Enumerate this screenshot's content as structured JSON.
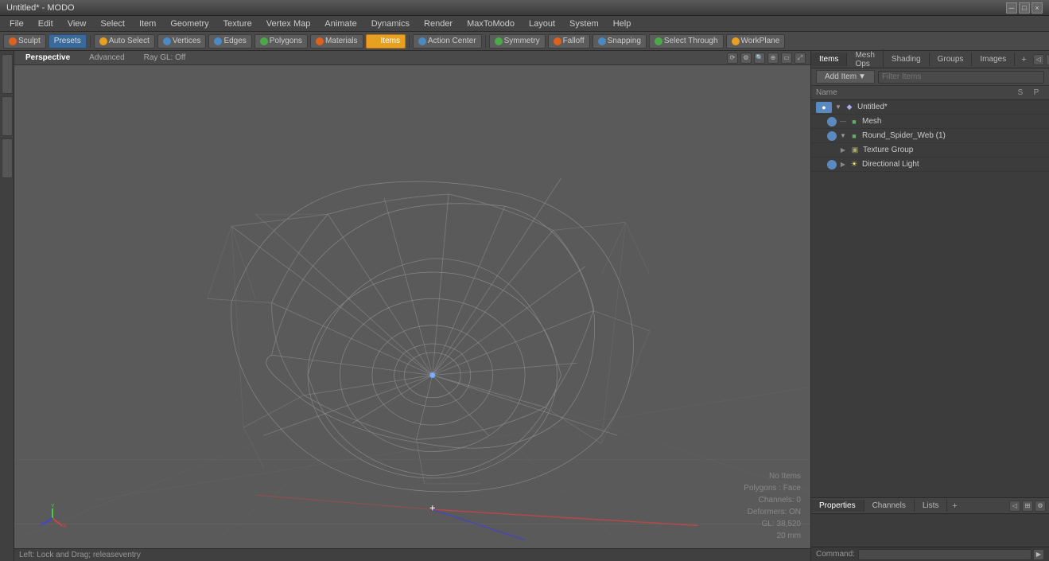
{
  "titlebar": {
    "title": "Untitled* - MODO",
    "controls": [
      "minimize",
      "maximize",
      "close"
    ]
  },
  "menubar": {
    "items": [
      "File",
      "Edit",
      "View",
      "Select",
      "Item",
      "Geometry",
      "Texture",
      "Vertex Map",
      "Animate",
      "Dynamics",
      "Render",
      "MaxToModo",
      "Layout",
      "System",
      "Help"
    ]
  },
  "toolbar": {
    "sculpt_label": "Sculpt",
    "presets_label": "Presets",
    "auto_select_label": "Auto Select",
    "vertices_label": "Vertices",
    "edges_label": "Edges",
    "polygons_label": "Polygons",
    "materials_label": "Materials",
    "items_label": "Items",
    "action_center_label": "Action Center",
    "symmetry_label": "Symmetry",
    "falloff_label": "Falloff",
    "snapping_label": "Snapping",
    "select_through_label": "Select Through",
    "workplane_label": "WorkPlane"
  },
  "viewport": {
    "tabs": [
      "Perspective",
      "Advanced",
      "Ray GL: Off"
    ],
    "active_tab": "Perspective",
    "overlay_info": {
      "no_items": "No Items",
      "polygons": "Polygons : Face",
      "channels": "Channels: 0",
      "deformers": "Deformers: ON",
      "gl": "GL: 38,520",
      "unit": "20 mm"
    }
  },
  "right_panel": {
    "tabs": [
      "Items",
      "Mesh Ops",
      "Shading",
      "Groups",
      "Images"
    ],
    "active_tab": "Items",
    "plus_label": "+",
    "add_item_label": "Add Item",
    "add_item_arrow": "▼",
    "filter_placeholder": "Filter Items",
    "tree_header": {
      "name_col": "Name",
      "s_col": "S",
      "p_col": "P"
    },
    "scene_tree": [
      {
        "id": "untitled",
        "label": "Untitled*",
        "type": "scene",
        "indent": 0,
        "expanded": true,
        "selected": false,
        "has_eye": false
      },
      {
        "id": "mesh",
        "label": "Mesh",
        "type": "mesh",
        "indent": 1,
        "expanded": false,
        "selected": false,
        "has_eye": true
      },
      {
        "id": "round_spider_web",
        "label": "Round_Spider_Web",
        "type": "mesh",
        "indent": 1,
        "expanded": true,
        "selected": false,
        "has_eye": true,
        "suffix": "(1)"
      },
      {
        "id": "texture_group",
        "label": "Texture Group",
        "type": "texture",
        "indent": 2,
        "expanded": false,
        "selected": false,
        "has_eye": false
      },
      {
        "id": "directional_light",
        "label": "Directional Light",
        "type": "light",
        "indent": 1,
        "expanded": false,
        "selected": false,
        "has_eye": true
      }
    ]
  },
  "bottom_right_panel": {
    "tabs": [
      "Properties",
      "Channels",
      "Lists"
    ],
    "active_tab": "Properties",
    "plus_label": "+"
  },
  "command_bar": {
    "label": "Command:",
    "placeholder": ""
  },
  "status_bar": {
    "text": "Left: Lock and Drag;  releaseventry"
  },
  "icons": {
    "eye": "●",
    "expand_open": "▼",
    "expand_closed": "▶",
    "mesh": "■",
    "scene": "◆",
    "texture": "▣",
    "light": "☀",
    "minimize": "─",
    "maximize": "□",
    "close": "×"
  }
}
